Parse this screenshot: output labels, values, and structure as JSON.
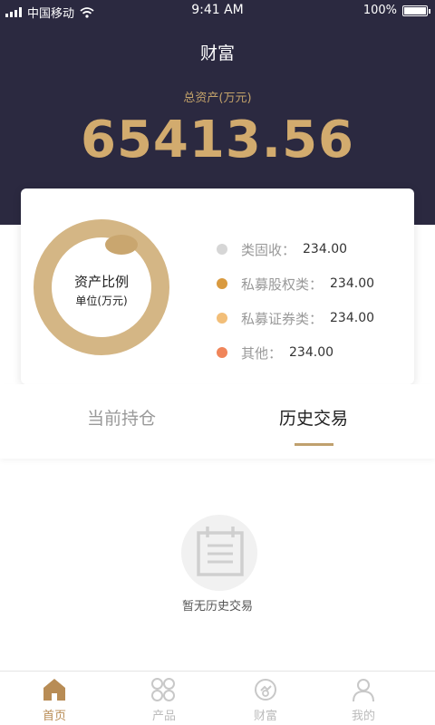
{
  "status_bar": {
    "carrier": "中国移动",
    "time": "9:41 AM",
    "battery": "100%"
  },
  "header": {
    "title": "财富",
    "asset_label": "总资产(万元)",
    "asset_value": "65413.56",
    "accent_color": "#d2ab6e",
    "background_color": "#2b2940"
  },
  "ratio_card": {
    "title": "资产比例",
    "subtitle": "单位(万元)",
    "legend": [
      {
        "name": "类固收：",
        "value": "234.00",
        "color": "#d6d6d6"
      },
      {
        "name": "私募股权类：",
        "value": "234.00",
        "color": "#d99a3f"
      },
      {
        "name": "私募证券类：",
        "value": "234.00",
        "color": "#f2be78"
      },
      {
        "name": "其他：",
        "value": "234.00",
        "color": "#f0855a"
      }
    ]
  },
  "tabs": {
    "current": "当前持仓",
    "history": "历史交易",
    "active": "history"
  },
  "empty_state": {
    "icon": "document-icon",
    "text": "暂无历史交易"
  },
  "tabbar": [
    {
      "label": "首页",
      "icon": "home-icon",
      "active": true
    },
    {
      "label": "产品",
      "icon": "grid-icon",
      "active": false
    },
    {
      "label": "财富",
      "icon": "wealth-icon",
      "active": false
    },
    {
      "label": "我的",
      "icon": "user-icon",
      "active": false
    }
  ]
}
